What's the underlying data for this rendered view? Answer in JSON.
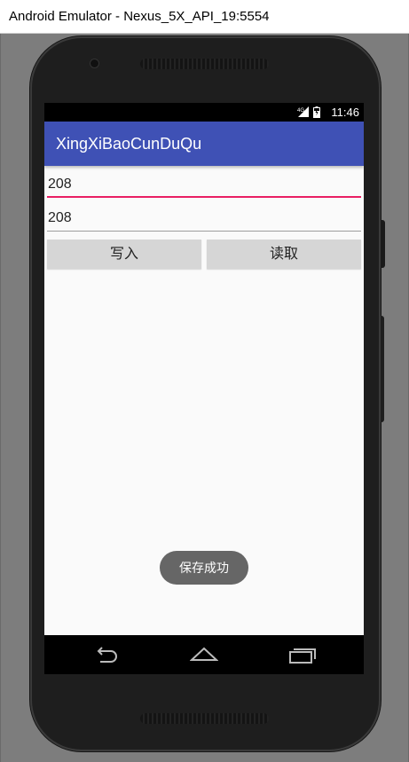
{
  "window": {
    "title": "Android Emulator - Nexus_5X_API_19:5554"
  },
  "statusbar": {
    "time": "11:46",
    "signal_icon": "signal-4g-icon",
    "battery_icon": "battery-charging-icon"
  },
  "app": {
    "title": "XingXiBaoCunDuQu"
  },
  "fields": {
    "input_value": "208",
    "output_value": "208"
  },
  "buttons": {
    "write_label": "写入",
    "read_label": "读取"
  },
  "toast": {
    "message": "保存成功"
  },
  "navbar": {
    "back_icon": "back-icon",
    "home_icon": "home-icon",
    "recents_icon": "recents-icon"
  },
  "colors": {
    "appbar": "#3f51b5",
    "accent": "#e91e63",
    "button": "#d6d6d6",
    "toast": "#666666"
  }
}
